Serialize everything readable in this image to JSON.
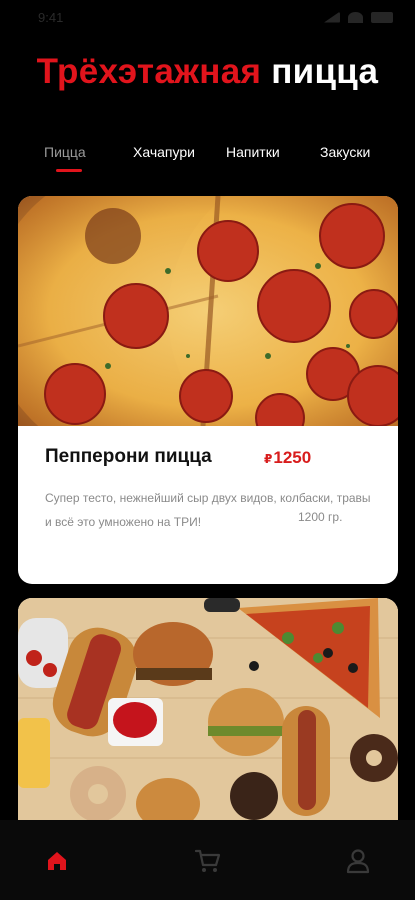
{
  "app": {
    "title_red": "Трёхэтажная",
    "title_white": "пицца"
  },
  "status_bar": {
    "time": "9:41"
  },
  "tabs": [
    {
      "label": "Пицца",
      "active": true
    },
    {
      "label": "Хачапури",
      "active": false
    },
    {
      "label": "Напитки",
      "active": false
    },
    {
      "label": "Закуски",
      "active": false
    }
  ],
  "products": [
    {
      "name": "Пепперони пицца",
      "currency": "₽",
      "price": "1250",
      "description": "Супер тесто, нежнейший сыр двух видов, колбаски, травы и всё это умножено на ТРИ!",
      "weight": "1200 гр."
    }
  ],
  "nav": [
    {
      "icon": "home-icon",
      "active": true
    },
    {
      "icon": "cart-icon",
      "active": false
    },
    {
      "icon": "profile-icon",
      "active": false
    }
  ],
  "colors": {
    "accent": "#e1141c",
    "background": "#000000",
    "card": "#ffffff",
    "price": "#d81c1c",
    "muted_text": "#8a8a8a"
  }
}
